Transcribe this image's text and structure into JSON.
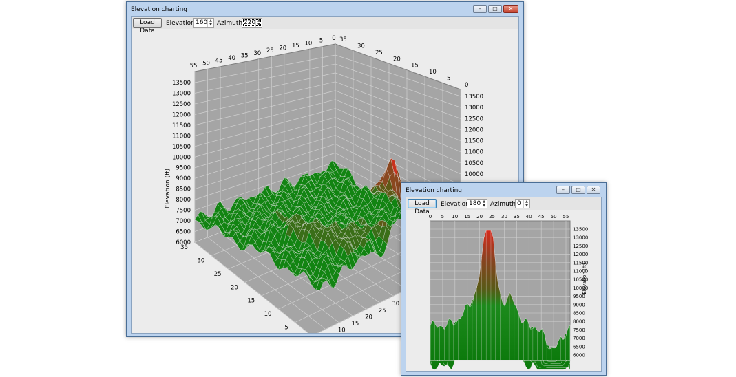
{
  "window_main": {
    "title": "Elevation charting",
    "min_icon": "minimize-icon",
    "max_icon": "maximize-icon",
    "close_icon": "close-icon",
    "toolbar": {
      "load_label": "Load Data",
      "elevation_label": "Elevation:",
      "elevation_value": "160",
      "azimuth_label": "Azimuth:",
      "azimuth_value": "220"
    },
    "chart_data": {
      "type": "surface",
      "zlabel": "Elevation (ft)",
      "z_ticks": [
        "6000",
        "6500",
        "7000",
        "7500",
        "8000",
        "8500",
        "9000",
        "9500",
        "10000",
        "10500",
        "11000",
        "11500",
        "12000",
        "12500",
        "13000",
        "13500"
      ],
      "x_ticks": [
        "0",
        "5",
        "10",
        "15",
        "20",
        "25",
        "30",
        "35",
        "40",
        "45",
        "50",
        "55"
      ],
      "y_ticks": [
        "0",
        "5",
        "10",
        "15",
        "20",
        "25",
        "30",
        "35"
      ],
      "zlim": [
        6000,
        13500
      ],
      "colors": {
        "low": "#0e7a0e",
        "mid": "#5a5a14",
        "high": "#d42a1e",
        "pane": "#a5a5a5",
        "grid": "#d0d0d0"
      }
    }
  },
  "window_small": {
    "title": "Elevation charting",
    "min_icon": "minimize-icon",
    "max_icon": "maximize-icon",
    "close_icon": "close-icon",
    "toolbar": {
      "load_label": "Load Data",
      "elevation_label": "Elevation:",
      "elevation_value": "180",
      "azimuth_label": "Azimuth:",
      "azimuth_value": "0"
    },
    "chart_data": {
      "type": "surface",
      "zlabel": "Elevation (ft)",
      "x_ticks": [
        "0",
        "5",
        "10",
        "15",
        "20",
        "25",
        "30",
        "35",
        "40",
        "45",
        "50",
        "55"
      ],
      "z_ticks": [
        "6000",
        "6500",
        "7000",
        "7500",
        "8000",
        "8500",
        "9000",
        "9500",
        "10000",
        "10500",
        "11000",
        "11500",
        "12000",
        "12500",
        "13000",
        "13500"
      ],
      "zlim": [
        6000,
        13500
      ]
    }
  }
}
